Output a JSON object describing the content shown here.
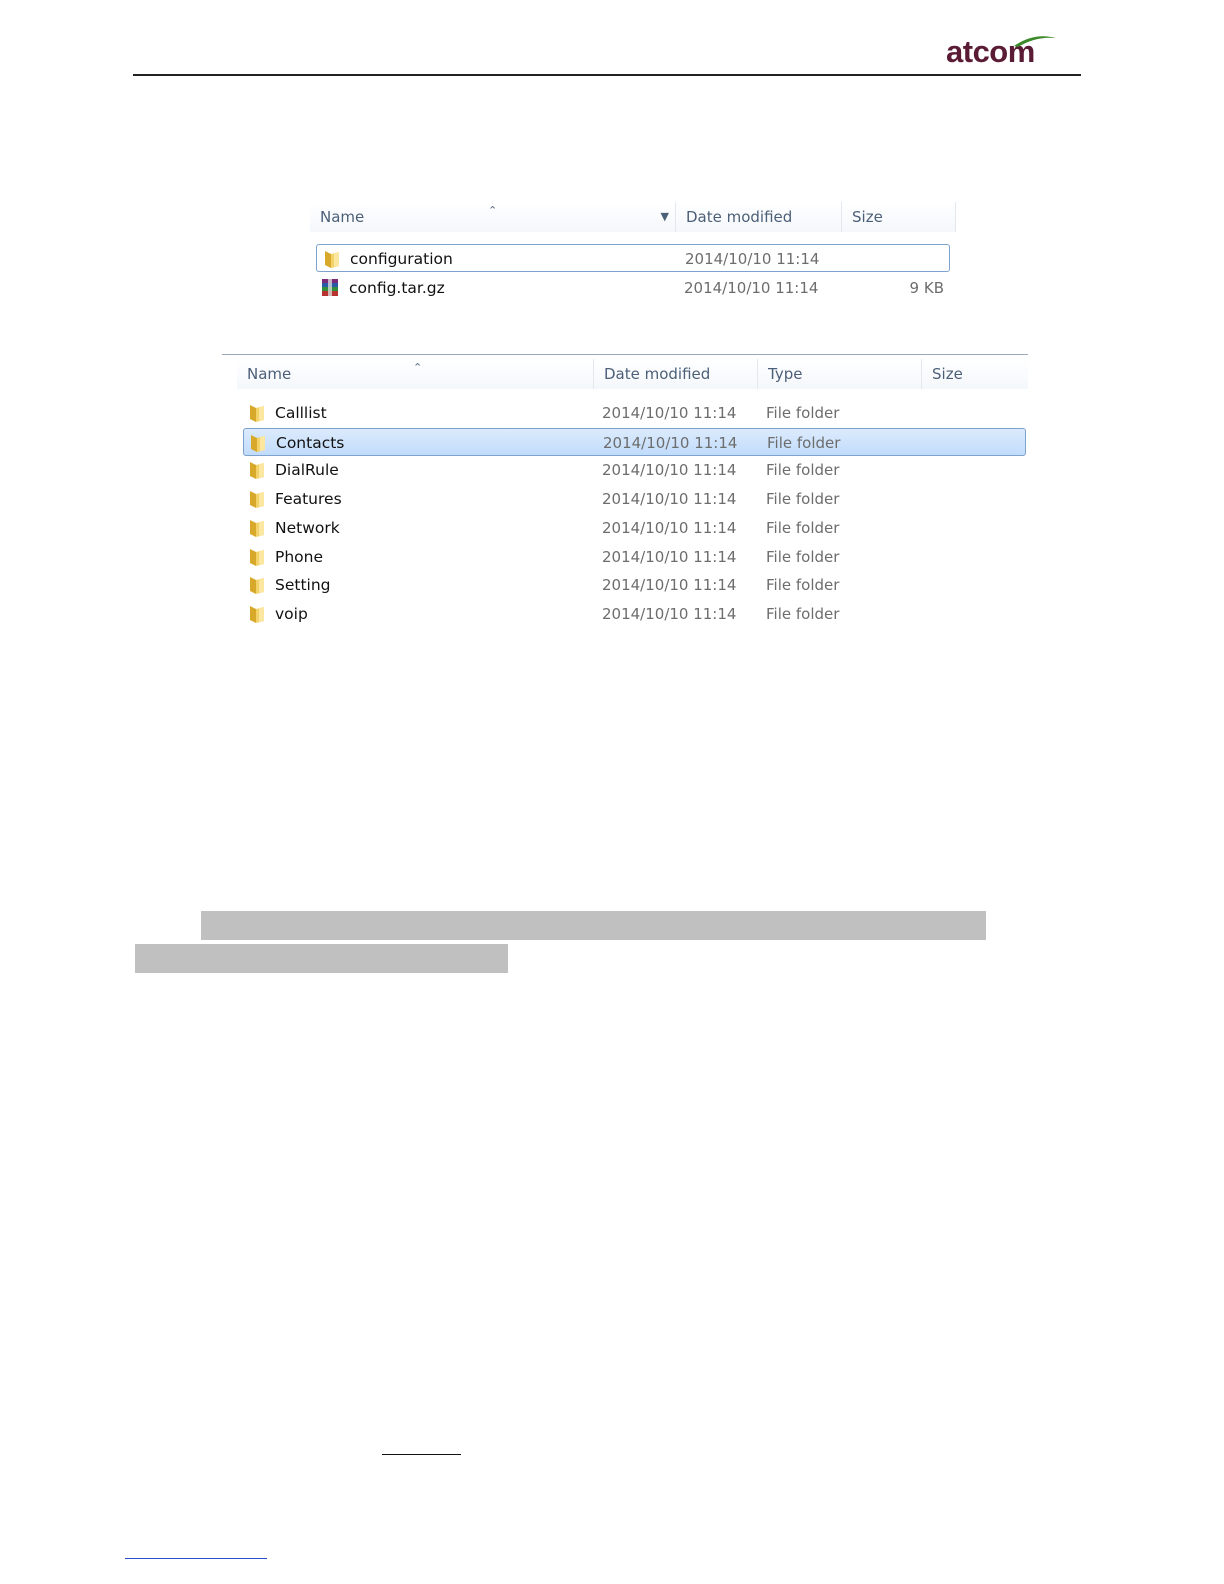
{
  "header": {
    "logo_text": "atcom",
    "logo_color": "#5a1b35",
    "logo_swoosh_color": "#3b8a2a"
  },
  "explorer1": {
    "columns": {
      "name": "Name",
      "date": "Date modified",
      "size": "Size"
    },
    "rows": [
      {
        "name": "configuration",
        "date": "2014/10/10 11:14",
        "size": "",
        "icon": "folder-icon"
      },
      {
        "name": "config.tar.gz",
        "date": "2014/10/10 11:14",
        "size": "9 KB",
        "icon": "archive-icon"
      }
    ]
  },
  "explorer2": {
    "columns": {
      "name": "Name",
      "date": "Date modified",
      "type": "Type",
      "size": "Size"
    },
    "rows": [
      {
        "name": "Calllist",
        "date": "2014/10/10 11:14",
        "type": "File folder"
      },
      {
        "name": "Contacts",
        "date": "2014/10/10 11:14",
        "type": "File folder"
      },
      {
        "name": "DialRule",
        "date": "2014/10/10 11:14",
        "type": "File folder"
      },
      {
        "name": "Features",
        "date": "2014/10/10 11:14",
        "type": "File folder"
      },
      {
        "name": "Network",
        "date": "2014/10/10 11:14",
        "type": "File folder"
      },
      {
        "name": "Phone",
        "date": "2014/10/10 11:14",
        "type": "File folder"
      },
      {
        "name": "Setting",
        "date": "2014/10/10 11:14",
        "type": "File folder"
      },
      {
        "name": "voip",
        "date": "2014/10/10 11:14",
        "type": "File folder"
      }
    ],
    "selected_row": "Contacts"
  },
  "colors": {
    "selection_border": "#7da2ce",
    "highlight_gray": "#c0c0c0",
    "link_dark": "#111111",
    "link_blue": "#2a4fd0"
  }
}
